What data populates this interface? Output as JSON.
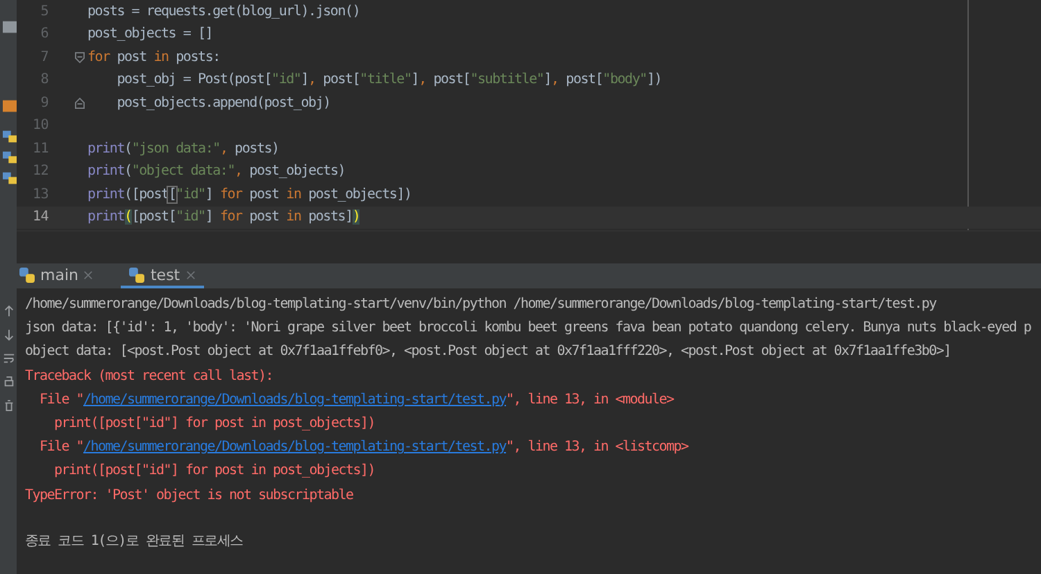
{
  "editor": {
    "lines": [
      {
        "number": "5",
        "fold_start": false,
        "fold_end": false,
        "tokens": [
          {
            "kind": "plain",
            "text": "posts = requests.get(blog_url).json()"
          }
        ]
      },
      {
        "number": "6",
        "fold_start": false,
        "fold_end": false,
        "tokens": [
          {
            "kind": "plain",
            "text": "post_objects = []"
          }
        ]
      },
      {
        "number": "7",
        "fold_start": true,
        "fold_end": false,
        "tokens": [
          {
            "kind": "kw",
            "text": "for"
          },
          {
            "kind": "plain",
            "text": " post "
          },
          {
            "kind": "kw",
            "text": "in"
          },
          {
            "kind": "plain",
            "text": " posts:"
          }
        ]
      },
      {
        "number": "8",
        "fold_start": false,
        "fold_end": false,
        "tokens": [
          {
            "kind": "plain",
            "text": "    post_obj = Post(post["
          },
          {
            "kind": "str",
            "text": "\"id\""
          },
          {
            "kind": "plain",
            "text": "]"
          },
          {
            "kind": "kw",
            "text": ","
          },
          {
            "kind": "plain",
            "text": " post["
          },
          {
            "kind": "str",
            "text": "\"title\""
          },
          {
            "kind": "plain",
            "text": "]"
          },
          {
            "kind": "kw",
            "text": ","
          },
          {
            "kind": "plain",
            "text": " post["
          },
          {
            "kind": "str",
            "text": "\"subtitle\""
          },
          {
            "kind": "plain",
            "text": "]"
          },
          {
            "kind": "kw",
            "text": ","
          },
          {
            "kind": "plain",
            "text": " post["
          },
          {
            "kind": "str",
            "text": "\"body\""
          },
          {
            "kind": "plain",
            "text": "])"
          }
        ]
      },
      {
        "number": "9",
        "fold_start": false,
        "fold_end": true,
        "tokens": [
          {
            "kind": "plain",
            "text": "    post_objects.append(post_obj)"
          }
        ]
      },
      {
        "number": "10",
        "fold_start": false,
        "fold_end": false
      },
      {
        "number": "11",
        "fold_start": false,
        "fold_end": false,
        "tokens": [
          {
            "kind": "builtin",
            "text": "print"
          },
          {
            "kind": "plain",
            "text": "("
          },
          {
            "kind": "str",
            "text": "\"json data:\""
          },
          {
            "kind": "kw",
            "text": ","
          },
          {
            "kind": "plain",
            "text": " posts)"
          }
        ]
      },
      {
        "number": "12",
        "fold_start": false,
        "fold_end": false,
        "tokens": [
          {
            "kind": "builtin",
            "text": "print"
          },
          {
            "kind": "plain",
            "text": "("
          },
          {
            "kind": "str",
            "text": "\"object data:\""
          },
          {
            "kind": "kw",
            "text": ","
          },
          {
            "kind": "plain",
            "text": " post_objects)"
          }
        ]
      },
      {
        "number": "13",
        "fold_start": false,
        "fold_end": false,
        "tokens": [
          {
            "kind": "builtin",
            "text": "print"
          },
          {
            "kind": "plain",
            "text": "([post"
          },
          {
            "kind": "boxed",
            "text": "["
          },
          {
            "kind": "str",
            "text": "\"id\""
          },
          {
            "kind": "plain",
            "text": "] "
          },
          {
            "kind": "kw",
            "text": "for"
          },
          {
            "kind": "plain",
            "text": " post "
          },
          {
            "kind": "kw",
            "text": "in"
          },
          {
            "kind": "plain",
            "text": " post_objects])"
          }
        ]
      },
      {
        "number": "14",
        "fold_start": false,
        "fold_end": false,
        "current": true,
        "tokens": [
          {
            "kind": "builtin",
            "text": "print"
          },
          {
            "kind": "match",
            "text": "("
          },
          {
            "kind": "plain",
            "text": "[post["
          },
          {
            "kind": "str",
            "text": "\"id\""
          },
          {
            "kind": "plain",
            "text": "] "
          },
          {
            "kind": "kw",
            "text": "for"
          },
          {
            "kind": "plain",
            "text": " post "
          },
          {
            "kind": "kw",
            "text": "in"
          },
          {
            "kind": "plain",
            "text": " posts]"
          },
          {
            "kind": "match",
            "text": ")"
          }
        ]
      }
    ]
  },
  "run_tabs": [
    {
      "label": "main",
      "selected": false
    },
    {
      "label": "test",
      "selected": true
    }
  ],
  "console": {
    "lines": [
      {
        "segments": [
          {
            "kind": "out",
            "text": "/home/summerorange/Downloads/blog-templating-start/venv/bin/python /home/summerorange/Downloads/blog-templating-start/test.py"
          }
        ]
      },
      {
        "segments": [
          {
            "kind": "out",
            "text": "json data: [{'id': 1, 'body': 'Nori grape silver beet broccoli kombu beet greens fava bean potato quandong celery. Bunya nuts black-eyed p"
          }
        ]
      },
      {
        "segments": [
          {
            "kind": "out",
            "text": "object data: [<post.Post object at 0x7f1aa1ffebf0>, <post.Post object at 0x7f1aa1fff220>, <post.Post object at 0x7f1aa1ffe3b0>]"
          }
        ]
      },
      {
        "segments": [
          {
            "kind": "err",
            "text": "Traceback (most recent call last):"
          }
        ]
      },
      {
        "segments": [
          {
            "kind": "err",
            "text": "  File \""
          },
          {
            "kind": "link",
            "text": "/home/summerorange/Downloads/blog-templating-start/test.py"
          },
          {
            "kind": "err",
            "text": "\", line 13, in <module>"
          }
        ]
      },
      {
        "segments": [
          {
            "kind": "err",
            "text": "    print([post[\"id\"] for post in post_objects])"
          }
        ]
      },
      {
        "segments": [
          {
            "kind": "err",
            "text": "  File \""
          },
          {
            "kind": "link",
            "text": "/home/summerorange/Downloads/blog-templating-start/test.py"
          },
          {
            "kind": "err",
            "text": "\", line 13, in <listcomp>"
          }
        ]
      },
      {
        "segments": [
          {
            "kind": "err",
            "text": "    print([post[\"id\"] for post in post_objects])"
          }
        ]
      },
      {
        "segments": [
          {
            "kind": "err",
            "text": "TypeError: 'Post' object is not subscriptable"
          }
        ]
      },
      {
        "kind": "exit",
        "segments": [
          {
            "kind": "out",
            "text": "종료 코드 1(으)로 완료된 프로세스"
          }
        ]
      }
    ]
  }
}
